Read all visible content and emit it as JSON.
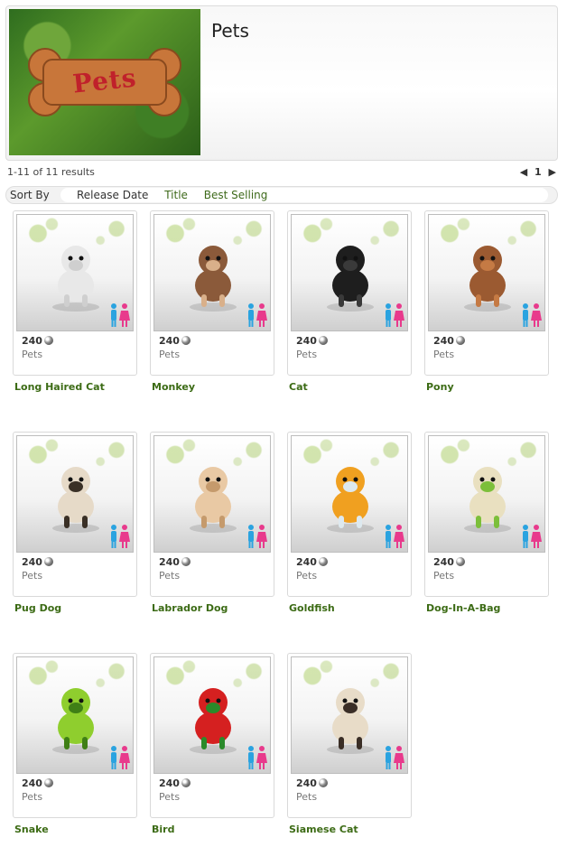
{
  "banner": {
    "title": "Pets",
    "art_word": "Pets"
  },
  "results": {
    "summary": "1-11 of 11 results",
    "page": "1",
    "prev_icon": "triangle-left-icon",
    "next_icon": "triangle-right-icon"
  },
  "sort": {
    "label": "Sort By",
    "options": [
      "Release Date",
      "Title",
      "Best Selling"
    ]
  },
  "items": [
    {
      "name": "Long Haired Cat",
      "price": "240",
      "category": "Pets",
      "icon": "long-haired-cat-icon",
      "colors": [
        "#e8e8e8",
        "#cfcfcf"
      ]
    },
    {
      "name": "Monkey",
      "price": "240",
      "category": "Pets",
      "icon": "monkey-icon",
      "colors": [
        "#8b5a3a",
        "#d9b08a"
      ]
    },
    {
      "name": "Cat",
      "price": "240",
      "category": "Pets",
      "icon": "cat-icon",
      "colors": [
        "#1e1e1e",
        "#3a3a3a"
      ]
    },
    {
      "name": "Pony",
      "price": "240",
      "category": "Pets",
      "icon": "pony-icon",
      "colors": [
        "#9b5a31",
        "#c57a44"
      ]
    },
    {
      "name": "Pug Dog",
      "price": "240",
      "category": "Pets",
      "icon": "pug-dog-icon",
      "colors": [
        "#e6dac8",
        "#3a3026"
      ]
    },
    {
      "name": "Labrador Dog",
      "price": "240",
      "category": "Pets",
      "icon": "labrador-dog-icon",
      "colors": [
        "#e9c9a4",
        "#c59a6c"
      ]
    },
    {
      "name": "Goldfish",
      "price": "240",
      "category": "Pets",
      "icon": "goldfish-icon",
      "colors": [
        "#f0a020",
        "#dde9ef"
      ]
    },
    {
      "name": "Dog-In-A-Bag",
      "price": "240",
      "category": "Pets",
      "icon": "dog-in-a-bag-icon",
      "colors": [
        "#e9e0c0",
        "#7cbf3a"
      ]
    },
    {
      "name": "Snake",
      "price": "240",
      "category": "Pets",
      "icon": "snake-icon",
      "colors": [
        "#8fce2e",
        "#3f7f16"
      ]
    },
    {
      "name": "Bird",
      "price": "240",
      "category": "Pets",
      "icon": "parrot-icon",
      "colors": [
        "#d52020",
        "#2a8a2a"
      ]
    },
    {
      "name": "Siamese Cat",
      "price": "240",
      "category": "Pets",
      "icon": "siamese-cat-icon",
      "colors": [
        "#e8dcc8",
        "#3a2e26"
      ]
    }
  ]
}
